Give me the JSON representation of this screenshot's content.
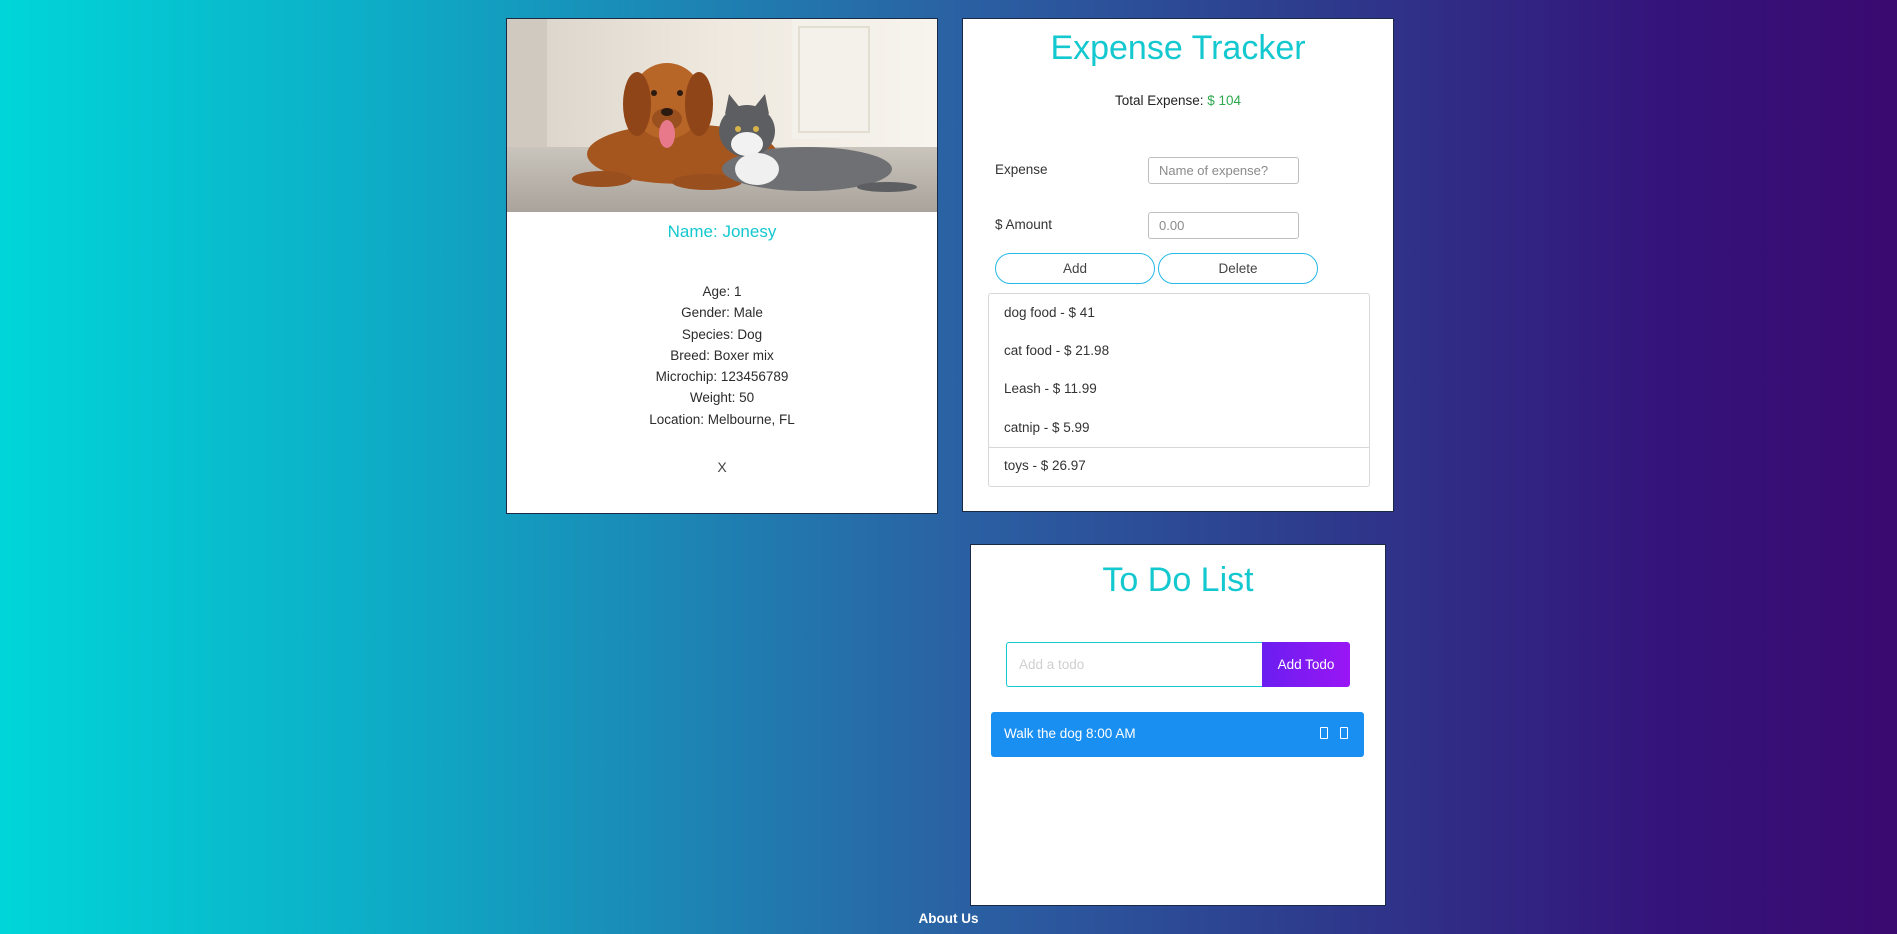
{
  "pet": {
    "name_label": "Name: Jonesy",
    "details": [
      "Age: 1",
      "Gender: Male",
      "Species: Dog",
      "Breed: Boxer mix",
      "Microchip: 123456789",
      "Weight: 50",
      "Location: Melbourne, FL"
    ],
    "close_label": "X"
  },
  "expense": {
    "title": "Expense Tracker",
    "total_label": "Total Expense: ",
    "total_value": "$ 104",
    "expense_label": "Expense",
    "expense_placeholder": "Name of expense?",
    "amount_label": "$ Amount",
    "amount_placeholder": "0.00",
    "add_label": "Add",
    "delete_label": "Delete",
    "items": [
      "dog food - $ 41",
      "cat food - $ 21.98",
      "Leash - $ 11.99",
      "catnip - $ 5.99",
      "toys - $ 26.97"
    ]
  },
  "todo": {
    "title": "To Do List",
    "input_placeholder": "Add a todo",
    "add_label": "Add Todo",
    "items": [
      {
        "text": "Walk the dog 8:00 AM"
      }
    ]
  },
  "footer": {
    "about_label": "About Us"
  },
  "colors": {
    "accent": "#14c8cf",
    "todo_row": "#1a8ff2",
    "add_todo_button": "#7a1af3",
    "total_amount": "#2fa84f"
  }
}
